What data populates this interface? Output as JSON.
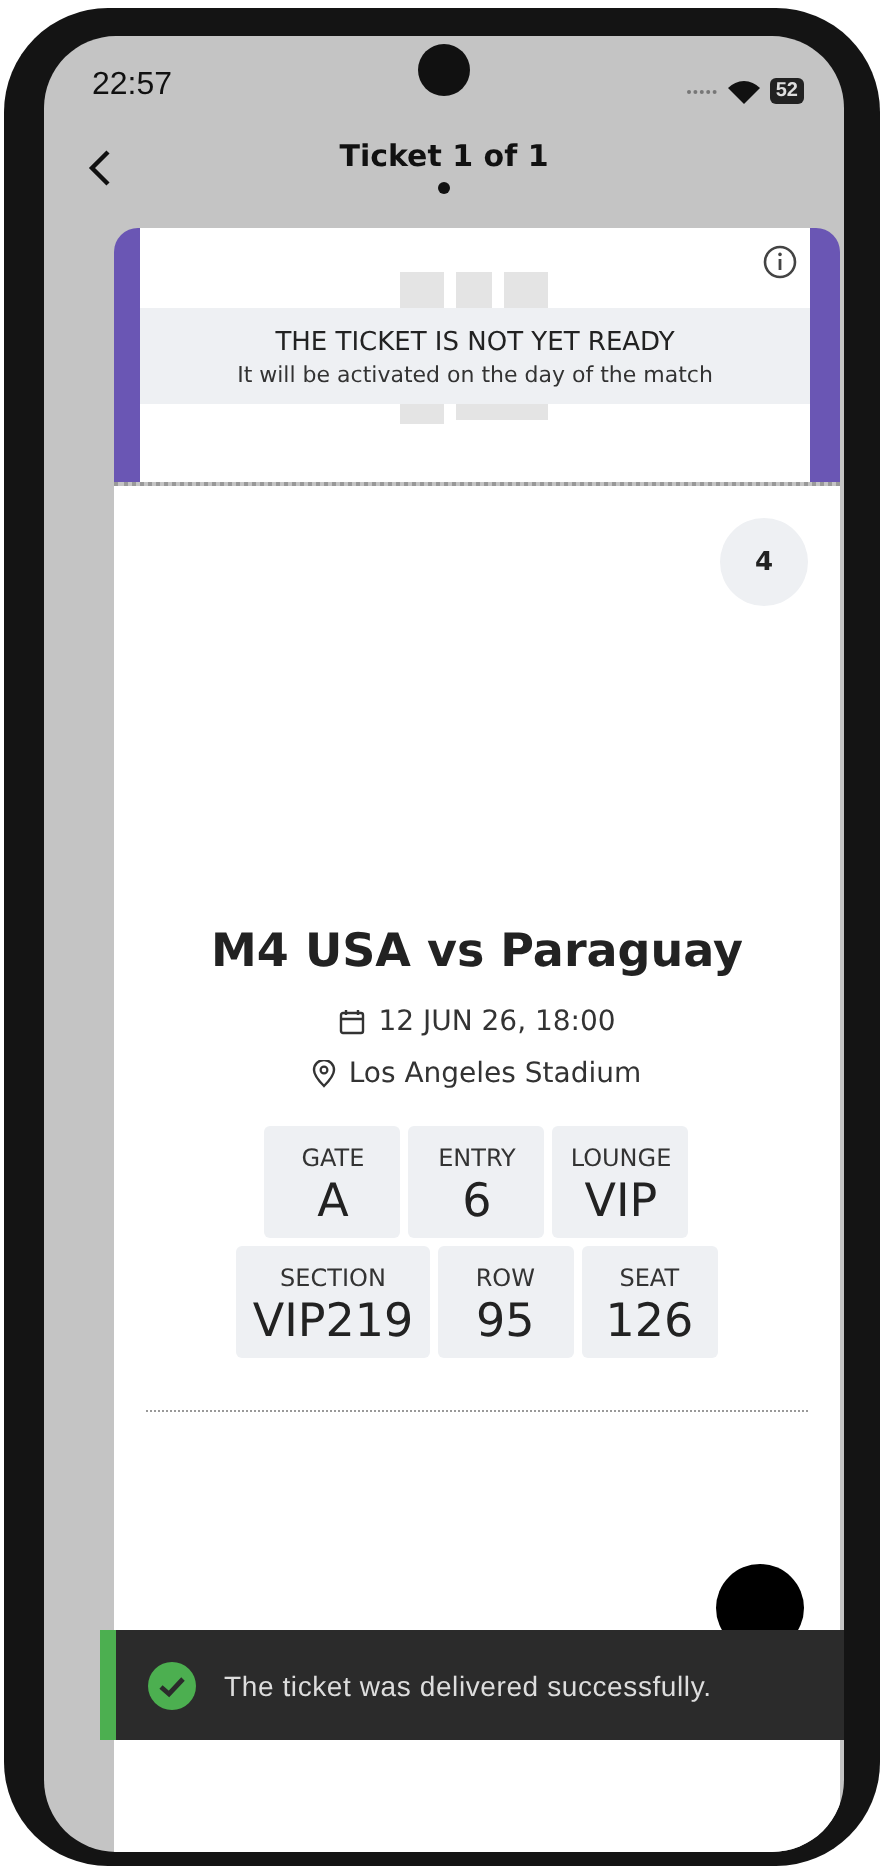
{
  "status_bar": {
    "time": "22:57",
    "battery": "52"
  },
  "header": {
    "title": "Ticket 1 of 1",
    "pages": [
      {
        "selected": true
      }
    ]
  },
  "notice": {
    "title": "THE TICKET IS NOT YET READY",
    "subtitle": "It will be activated on the day of the match"
  },
  "ticket": {
    "badge": "4",
    "match": "M4 USA vs Paraguay",
    "date": "12 JUN 26, 18:00",
    "venue": "Los Angeles Stadium",
    "seat_rows": [
      [
        {
          "label": "GATE",
          "value": "A"
        },
        {
          "label": "ENTRY",
          "value": "6"
        },
        {
          "label": "LOUNGE",
          "value": "VIP"
        }
      ],
      [
        {
          "label": "SECTION",
          "value": "VIP219"
        },
        {
          "label": "ROW",
          "value": "95"
        },
        {
          "label": "SEAT",
          "value": "126"
        }
      ]
    ]
  },
  "toast": {
    "message": "The ticket was delivered successfully."
  }
}
